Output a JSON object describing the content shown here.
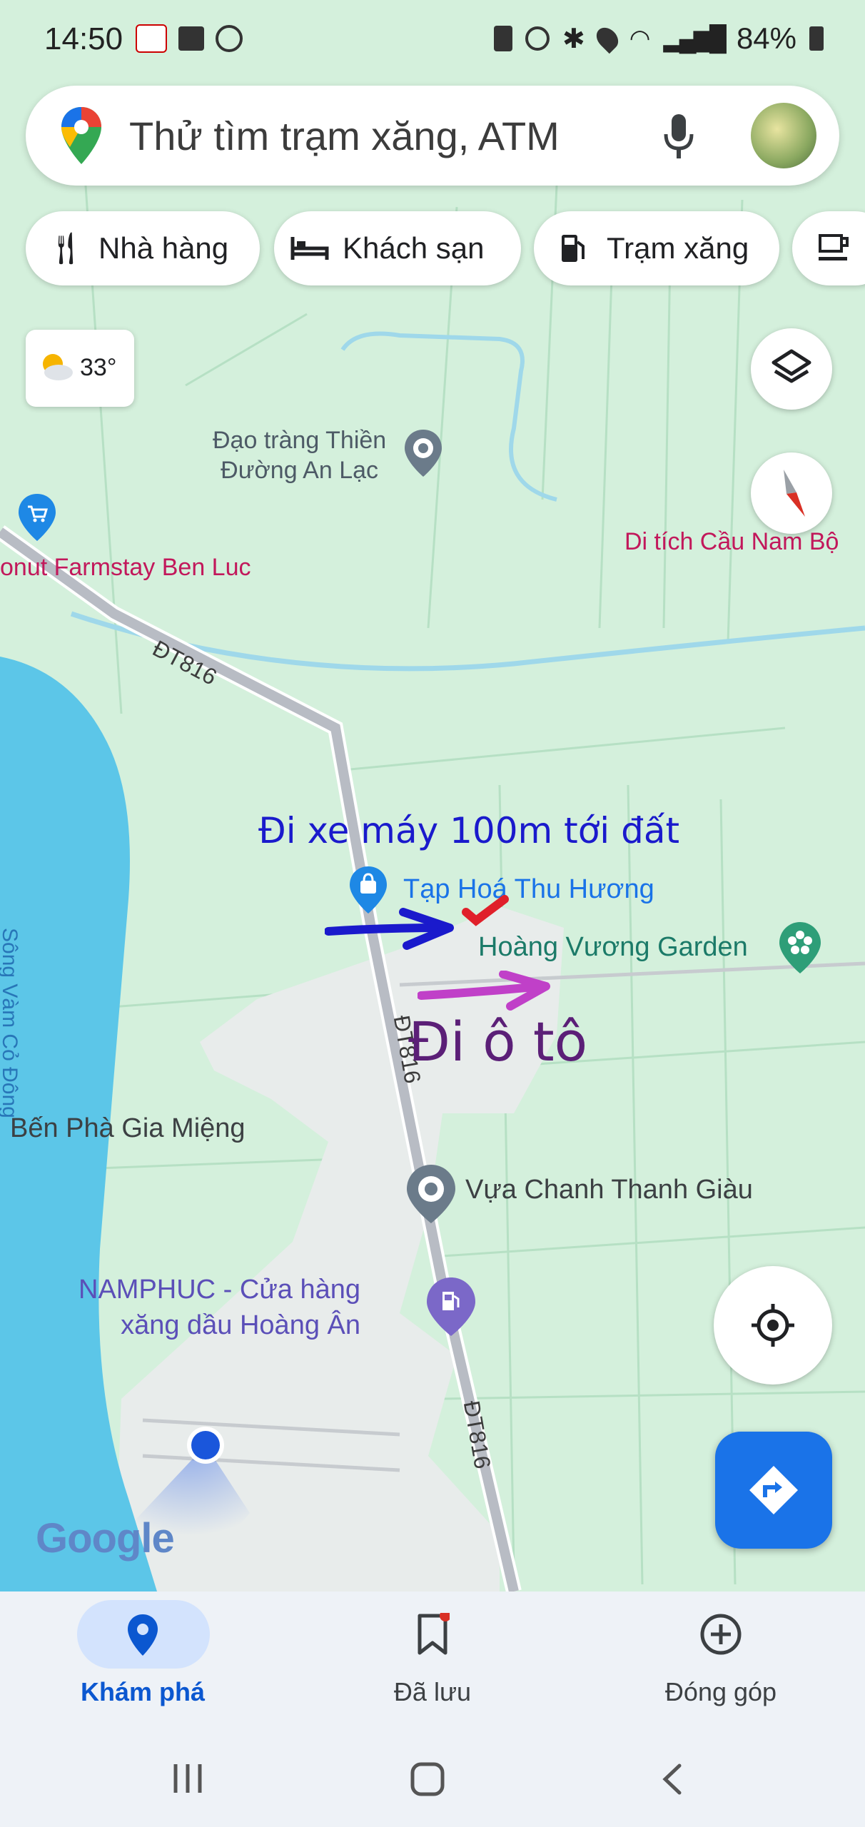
{
  "status_bar": {
    "time": "14:50",
    "battery": "84%",
    "icons": [
      "vnpay-icon",
      "gallery-icon",
      "whatsapp-icon",
      "sim-icon",
      "alarm-icon",
      "bluetooth-icon",
      "location-icon",
      "wifi-icon",
      "signal-icon",
      "battery-icon"
    ]
  },
  "search": {
    "placeholder": "Thử tìm trạm xăng, ATM"
  },
  "chips": [
    {
      "label": "Nhà hàng",
      "icon": "restaurant-icon"
    },
    {
      "label": "Khách sạn",
      "icon": "hotel-icon"
    },
    {
      "label": "Trạm xăng",
      "icon": "gas-station-icon"
    }
  ],
  "weather": {
    "temp": "33°"
  },
  "map_labels": {
    "dao_trang": [
      "Đạo tràng Thiền",
      "Đường An Lạc"
    ],
    "di_tich": "Di tích Cầu Nam Bộ",
    "farmstay": "onut Farmstay Ben Luc",
    "road_1": "ĐT816",
    "road_2": "ĐT816",
    "road_3": "ĐT816",
    "river": "Sông Vàm Cỏ Đông",
    "tap_hoa": "Tạp Hoá Thu Hương",
    "hoang_vuong": "Hoàng Vương Garden",
    "ben_pha": "Bến Phà Gia Miệng",
    "vua_chanh": "Vựa Chanh Thanh Giàu",
    "namphuc": [
      "NAMPHUC - Cửa hàng",
      "xăng dầu Hoàng Ân"
    ],
    "google": "Google"
  },
  "annotations": {
    "blue_text": "Đi xe máy 100m tới đất",
    "purple_text": "Đi ô tô"
  },
  "colors": {
    "map_bg": "#d4f0dc",
    "water": "#5cc6e8",
    "road": "#b8bcc4",
    "pink_label": "#c2185b",
    "teal_label": "#1b7a68",
    "blue_annot": "#1a1acc",
    "purple_annot": "#5b1f77",
    "magenta_arrow": "#c040c8",
    "directions_btn": "#1a73e8"
  },
  "bottom_nav": [
    {
      "label": "Khám phá",
      "icon": "explore-pin-icon",
      "active": true
    },
    {
      "label": "Đã lưu",
      "icon": "bookmark-icon",
      "active": false
    },
    {
      "label": "Đóng góp",
      "icon": "add-circle-icon",
      "active": false
    }
  ],
  "system_nav": [
    "recents-icon",
    "home-icon",
    "back-icon"
  ]
}
